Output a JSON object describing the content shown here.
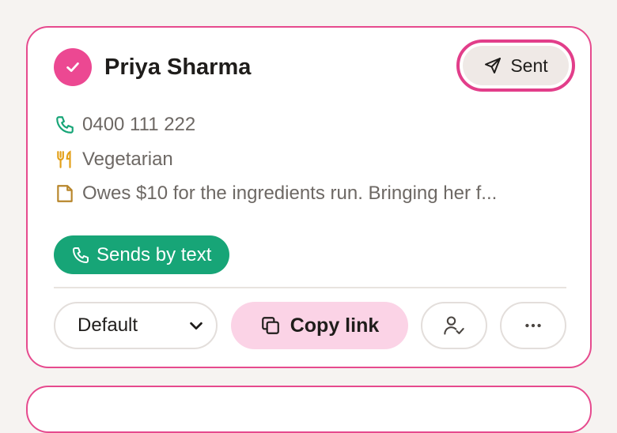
{
  "guest": {
    "name": "Priya Sharma",
    "status_label": "Sent",
    "phone": "0400 111 222",
    "dietary": "Vegetarian",
    "note": "Owes $10 for the ingredients run. Bringing her f..."
  },
  "delivery": {
    "label": "Sends by text"
  },
  "actions": {
    "template_selected": "Default",
    "copy_label": "Copy link"
  },
  "icons": {
    "check": "check-icon",
    "send": "send-icon",
    "phone": "phone-icon",
    "utensils": "utensils-icon",
    "note": "note-icon",
    "copy": "copy-icon",
    "assign": "user-check-icon",
    "more": "more-horizontal-icon",
    "chevron": "chevron-down-icon"
  },
  "colors": {
    "accent": "#e64a8e",
    "pill_green": "#17a577",
    "phone_icon": "#17a577",
    "dietary_icon": "#e3a019",
    "note_icon": "#b8862b",
    "copy_bg": "#fbd3e6"
  }
}
